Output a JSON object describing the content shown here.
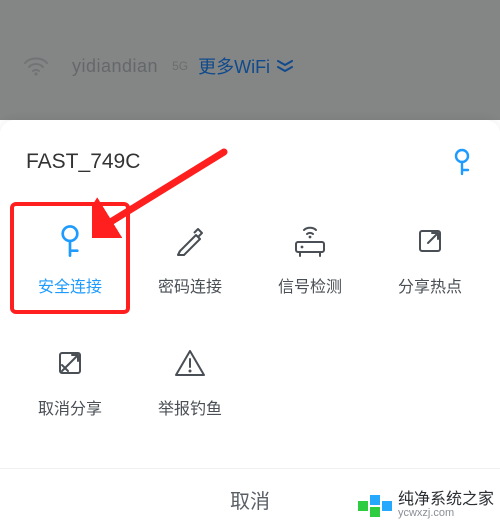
{
  "background": {
    "ssid": "yidiandian",
    "band_tag": "5G",
    "more_label": "更多WiFi"
  },
  "sheet": {
    "title": "FAST_749C",
    "header_icon": "key-icon",
    "actions": [
      {
        "icon": "key-icon",
        "label": "安全连接",
        "selected": true
      },
      {
        "icon": "pencil-icon",
        "label": "密码连接",
        "selected": false
      },
      {
        "icon": "router-icon",
        "label": "信号检测",
        "selected": false
      },
      {
        "icon": "share-icon",
        "label": "分享热点",
        "selected": false
      },
      {
        "icon": "unshare-icon",
        "label": "取消分享",
        "selected": false
      },
      {
        "icon": "warning-icon",
        "label": "举报钓鱼",
        "selected": false
      }
    ],
    "cancel_label": "取消"
  },
  "watermark": {
    "text": "纯净系统之家",
    "url": "ycwxzj.com"
  },
  "colors": {
    "accent": "#1e9bff",
    "annotation": "#ff1f1f",
    "text": "#4a4f55"
  }
}
